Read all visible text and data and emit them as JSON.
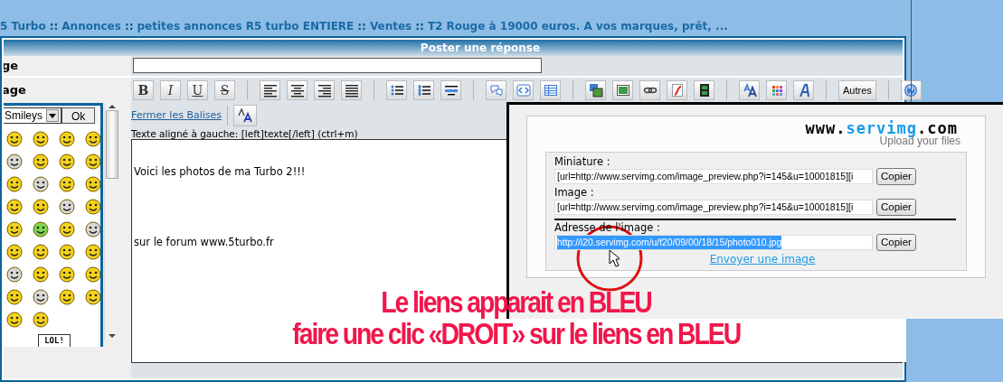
{
  "breadcrumb": [
    {
      "kind": "link",
      "text": "5 Turbo"
    },
    {
      "kind": "separator",
      "text": "::"
    },
    {
      "kind": "link",
      "text": "Annonces"
    },
    {
      "kind": "separator",
      "text": "::"
    },
    {
      "kind": "link",
      "text": "petites annonces R5 turbo ENTIERE"
    },
    {
      "kind": "separator",
      "text": "::"
    },
    {
      "kind": "link",
      "text": "Ventes"
    },
    {
      "kind": "separator",
      "text": "::"
    },
    {
      "kind": "link",
      "text": "T2 Rouge à 19000 euros. A vos marques, prêt, ..."
    }
  ],
  "panel": {
    "title": "Poster une réponse"
  },
  "subject": {
    "label": "ge"
  },
  "message": {
    "label": "age",
    "close_tags": "Fermer les Balises",
    "hint": "Texte aligné à gauche: [left]texte[/left] (ctrl+m)",
    "text": "Voici les photos de ma Turbo 2!!!\n\n\n\n\nsur le forum www.5turbo.fr"
  },
  "toolbar": {
    "format_buttons": [
      "B",
      "I",
      "U",
      "S"
    ],
    "more_button": "Autres"
  },
  "smileys": {
    "select": "Smileys",
    "ok": "Ok",
    "lol_sign": "LOL!"
  },
  "upload_popup": {
    "logo": {
      "prefix": "www.",
      "name": "servimg",
      "suffix": ".com"
    },
    "tagline": "Upload your files",
    "fields": [
      {
        "label": "Miniature :",
        "value": "[url=http://www.servimg.com/image_preview.php?i=145&u=10001815][i",
        "selected": false,
        "button": "Copier"
      },
      {
        "label": "Image :",
        "value": "[url=http://www.servimg.com/image_preview.php?i=145&u=10001815][i",
        "selected": false,
        "button": "Copier"
      },
      {
        "label": "Adresse de l'image :",
        "value": "http://i20.servimg.com/u/f20/09/00/18/15/photo010.jpg",
        "selected": true,
        "button": "Copier"
      }
    ],
    "send_link": "Envoyer une image"
  },
  "annotation": [
    "Le liens apparait en BLEU",
    "faire une clic «DROIT» sur le liens en BLEU"
  ]
}
